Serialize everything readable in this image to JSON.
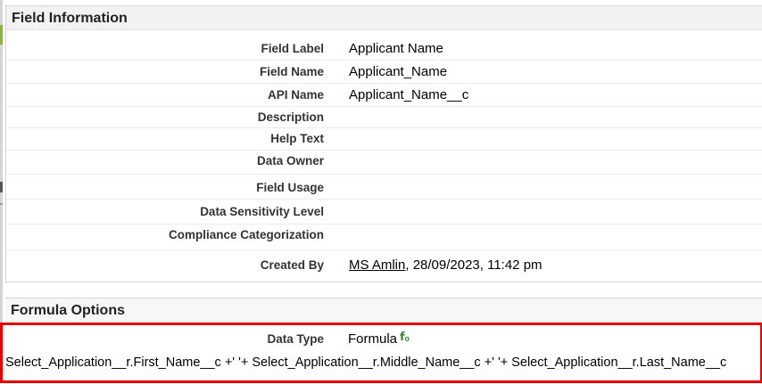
{
  "field_information": {
    "title": "Field Information",
    "rows": [
      {
        "label": "Field Label",
        "value": "Applicant Name"
      },
      {
        "label": "Field Name",
        "value": "Applicant_Name"
      },
      {
        "label": "API Name",
        "value": "Applicant_Name__c"
      },
      {
        "label": "Description",
        "value": ""
      },
      {
        "label": "Help Text",
        "value": ""
      },
      {
        "label": "Data Owner",
        "value": ""
      },
      {
        "label": "Field Usage",
        "value": ""
      },
      {
        "label": "Data Sensitivity Level",
        "value": ""
      },
      {
        "label": "Compliance Categorization",
        "value": ""
      }
    ],
    "created_by": {
      "label": "Created By",
      "user": "MS Amlin",
      "datetime": ", 28/09/2023, 11:42 pm"
    }
  },
  "formula_options": {
    "title": "Formula Options",
    "data_type_label": "Data Type",
    "data_type_value": "Formula",
    "formula_icon": "formula-icon",
    "formula": "Select_Application__r.First_Name__c +' '+ Select_Application__r.Middle_Name__c +' '+ Select_Application__r.Last_Name__c"
  },
  "colors": {
    "highlight": "#e60000",
    "header_bg": "#f2f2f2",
    "accent": "#8ab14a"
  }
}
